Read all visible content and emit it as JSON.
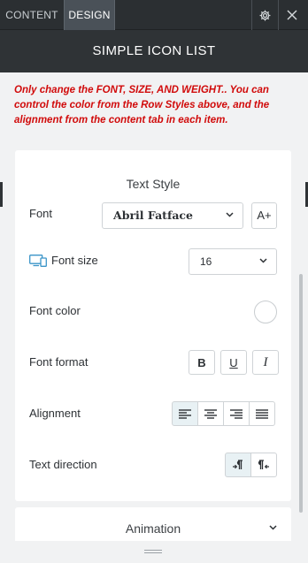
{
  "tabs": {
    "content": "CONTENT",
    "design": "DESIGN"
  },
  "header": {
    "title": "SIMPLE ICON LIST"
  },
  "note": "Only change the FONT, SIZE, AND WEIGHT.. You can control the color from the Row Styles above, and the alignment from the content tab in each item.",
  "text_style": {
    "title": "Text Style",
    "font_label": "Font",
    "font_value": "Abril Fatface",
    "font_add_label": "A+",
    "font_size_label": "Font size",
    "font_size_value": "16",
    "font_color_label": "Font color",
    "font_color_value": "#ffffff",
    "font_format_label": "Font format",
    "format_buttons": {
      "bold": "B",
      "underline": "U",
      "italic": "I"
    },
    "alignment_label": "Alignment",
    "alignment_selected": "left",
    "text_direction_label": "Text direction",
    "text_direction_selected": "ltr"
  },
  "animation": {
    "label": "Animation"
  },
  "colors": {
    "dark_bar": "#2f3336",
    "note_red": "#d10b0b",
    "active_button": "#e8f1f4"
  }
}
